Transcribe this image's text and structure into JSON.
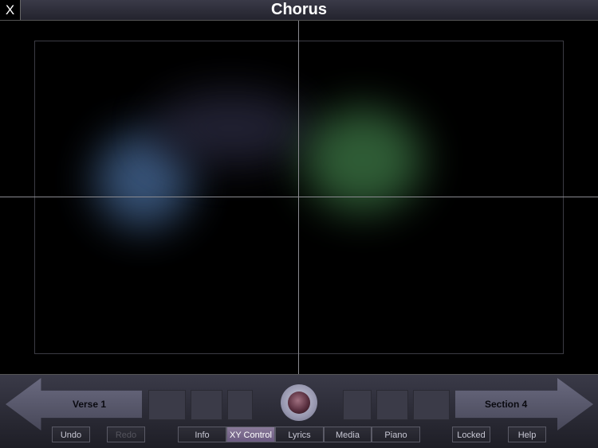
{
  "window": {
    "title": "Chorus",
    "close_label": "X"
  },
  "xy_area": {
    "blobs": [
      {
        "name": "blue-blob",
        "color": "#4a6fa0"
      },
      {
        "name": "purple-blob",
        "color": "#2a2a40"
      },
      {
        "name": "green-blob",
        "color": "#4f9a5a"
      }
    ]
  },
  "nav": {
    "prev_label": "Verse 1",
    "next_label": "Section 4"
  },
  "toolbar": {
    "undo": "Undo",
    "redo": "Redo",
    "info": "Info",
    "xy_control": "XY Control",
    "lyrics": "Lyrics",
    "media": "Media",
    "piano": "Piano",
    "locked": "Locked",
    "help": "Help"
  },
  "colors": {
    "accent": "#8a7a9a",
    "bar": "#2e2e38",
    "arrow": "#5a5a70"
  }
}
